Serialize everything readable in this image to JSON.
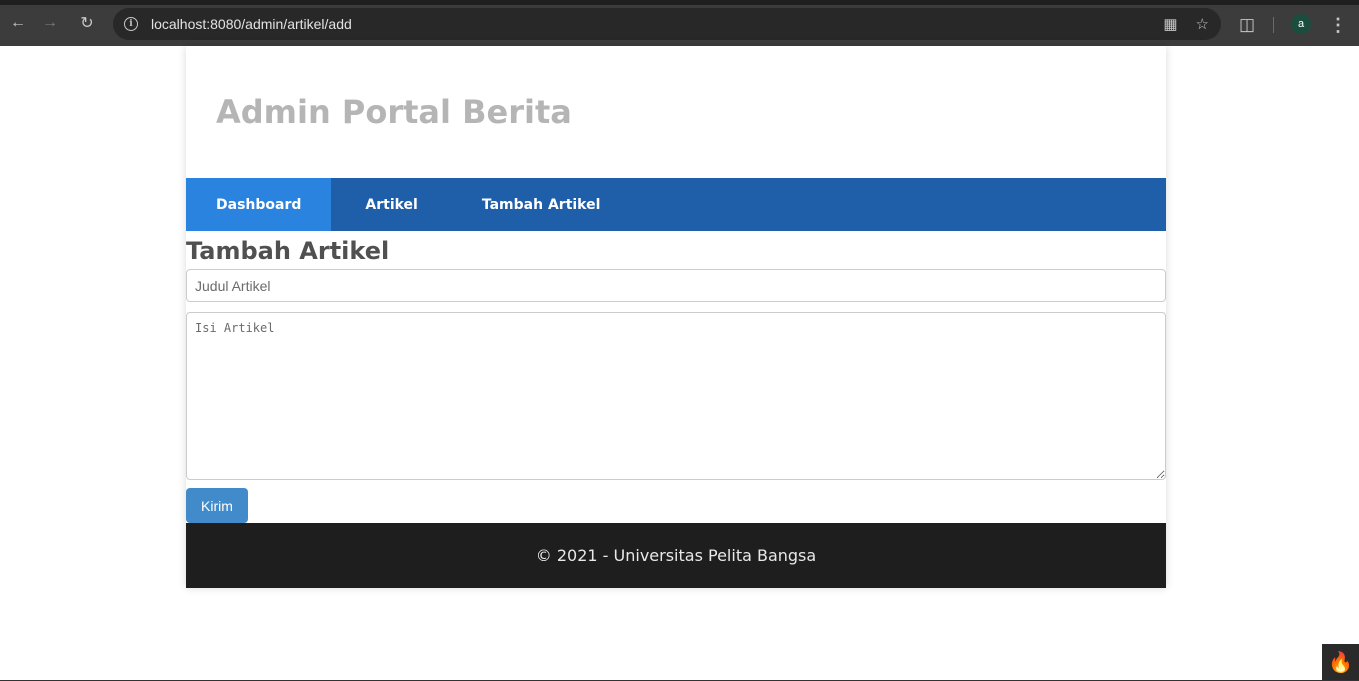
{
  "browser": {
    "url": "localhost:8080/admin/artikel/add",
    "avatar_letter": "a",
    "icons": [
      "back-icon",
      "forward-icon",
      "reload-icon",
      "site-info-icon",
      "translate-icon",
      "bookmark-star-icon",
      "extensions-icon",
      "menu-icon"
    ]
  },
  "header": {
    "title": "Admin Portal Berita"
  },
  "nav": {
    "items": [
      {
        "label": "Dashboard",
        "active": true
      },
      {
        "label": "Artikel",
        "active": false
      },
      {
        "label": "Tambah Artikel",
        "active": false
      }
    ]
  },
  "form": {
    "heading": "Tambah Artikel",
    "title_placeholder": "Judul Artikel",
    "title_value": "",
    "body_placeholder": "Isi Artikel",
    "body_value": "",
    "submit_label": "Kirim"
  },
  "footer": {
    "text": "© 2021 - Universitas Pelita Bangsa"
  },
  "colors": {
    "nav_bg": "#1f5faa",
    "nav_active": "#2b83e0",
    "button": "#428bca",
    "footer_bg": "#1e1e1e",
    "header_title": "#b5b5b5"
  }
}
